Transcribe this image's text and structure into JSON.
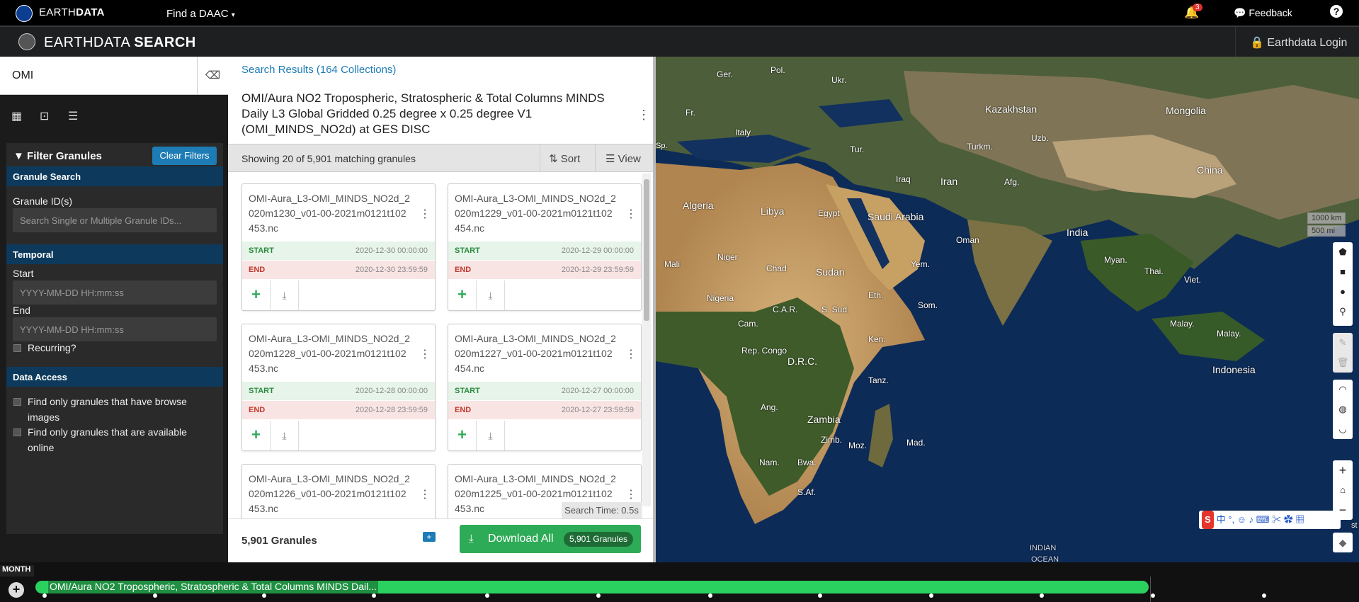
{
  "topbar": {
    "brand_light": "EARTH",
    "brand_bold": "DATA",
    "find_daac": "Find a DAAC",
    "notifications_count": "3",
    "feedback": "Feedback",
    "help": "?"
  },
  "header": {
    "title_light": "EARTHDATA ",
    "title_bold": "SEARCH",
    "login": "Earthdata Login"
  },
  "search": {
    "query": "OMI"
  },
  "filters": {
    "title": "Filter Granules",
    "clear": "Clear Filters",
    "granule_search_heading": "Granule Search",
    "granule_ids_label": "Granule ID(s)",
    "granule_ids_placeholder": "Search Single or Multiple Granule IDs...",
    "temporal_heading": "Temporal",
    "start_label": "Start",
    "start_placeholder": "YYYY-MM-DD HH:mm:ss",
    "end_label": "End",
    "end_placeholder": "YYYY-MM-DD HH:mm:ss",
    "recurring_label": "Recurring?",
    "data_access_heading": "Data Access",
    "browse_label": "Find only granules that have browse images",
    "online_label": "Find only granules that are available online"
  },
  "results": {
    "search_results": "Search Results (164 Collections)",
    "collection_title": "OMI/Aura NO2 Tropospheric, Stratospheric & Total Columns MINDS Daily L3 Global Gridded 0.25 degree x 0.25 degree V1 (OMI_MINDS_NO2d) at GES DISC",
    "showing": "Showing 20 of 5,901 matching granules",
    "sort": "Sort",
    "view": "View",
    "start_key": "START",
    "end_key": "END",
    "granules": [
      {
        "name": "OMI-Aura_L3-OMI_MINDS_NO2d_2020m1230_v01-00-2021m0121t102453.nc",
        "start": "2020-12-30 00:00:00",
        "end": "2020-12-30 23:59:59"
      },
      {
        "name": "OMI-Aura_L3-OMI_MINDS_NO2d_2020m1229_v01-00-2021m0121t102454.nc",
        "start": "2020-12-29 00:00:00",
        "end": "2020-12-29 23:59:59"
      },
      {
        "name": "OMI-Aura_L3-OMI_MINDS_NO2d_2020m1228_v01-00-2021m0121t102453.nc",
        "start": "2020-12-28 00:00:00",
        "end": "2020-12-28 23:59:59"
      },
      {
        "name": "OMI-Aura_L3-OMI_MINDS_NO2d_2020m1227_v01-00-2021m0121t102454.nc",
        "start": "2020-12-27 00:00:00",
        "end": "2020-12-27 23:59:59"
      },
      {
        "name": "OMI-Aura_L3-OMI_MINDS_NO2d_2020m1226_v01-00-2021m0121t102453.nc"
      },
      {
        "name": "OMI-Aura_L3-OMI_MINDS_NO2d_2020m1225_v01-00-2021m0121t102453.nc"
      }
    ],
    "search_time": "Search Time: 0.5s",
    "granule_count": "5,901 Granules",
    "download_all": "Download All",
    "download_pill": "5,901 Granules"
  },
  "map": {
    "scale_km": "1000 km",
    "scale_mi": "500 mi",
    "ime_text": "中 °, ☺ ♪ ⌨ ✂ ✿ ▦",
    "labels": [
      "Ger.",
      "Pol.",
      "Ukr.",
      "Fr.",
      "Italy",
      "Kazakhstan",
      "Mongolia",
      "Tur.",
      "Turkm.",
      "Uzb.",
      "Iraq",
      "Iran",
      "Afg.",
      "China",
      "Algeria",
      "Libya",
      "Egypt",
      "Saudi Arabia",
      "Oman",
      "India",
      "Mali",
      "Niger",
      "Chad",
      "Sudan",
      "Yem.",
      "Myan.",
      "Thai.",
      "Viet.",
      "Nigeria",
      "C.A.R.",
      "S. Sud.",
      "Eth.",
      "Som.",
      "Cam.",
      "Rep. Congo",
      "D.R.C.",
      "Ken.",
      "Malay.",
      "Malay.",
      "Tanz.",
      "Indonesia",
      "Ang.",
      "Zambia",
      "Zimb.",
      "Moz.",
      "Mad.",
      "Nam.",
      "Bwa.",
      "S.Af.",
      "INDIAN",
      "OCEAN",
      "Sp.",
      "st"
    ]
  },
  "timeline": {
    "month": "MONTH",
    "label": "OMI/Aura NO2 Tropospheric, Stratospheric & Total Columns MINDS Dail..."
  },
  "colors": {
    "accent": "#1d7cb6",
    "download": "#2eab57",
    "timeline": "#2bd15e"
  }
}
